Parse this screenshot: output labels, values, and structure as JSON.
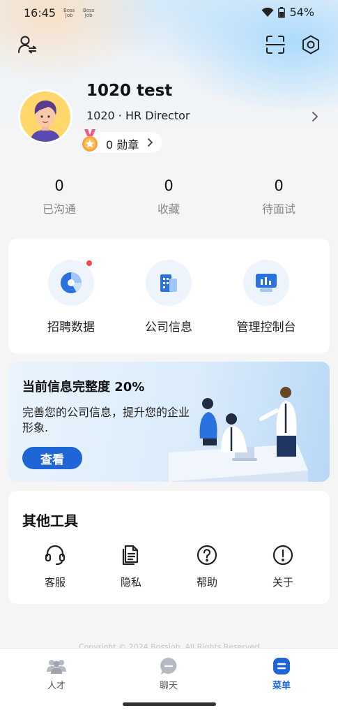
{
  "status_bar": {
    "time": "16:45",
    "mini_logo_line1": "Boss",
    "mini_logo_line2": "Job",
    "battery": "54%"
  },
  "header": {
    "left_icon": "user-switch-icon",
    "scan_icon": "scan-icon",
    "settings_icon": "settings-icon"
  },
  "profile": {
    "name": "1020 test",
    "role": "1020 · HR Director",
    "badge_count": "0 勋章"
  },
  "stats": [
    {
      "value": "0",
      "label": "已沟通"
    },
    {
      "value": "0",
      "label": "收藏"
    },
    {
      "value": "0",
      "label": "待面试"
    }
  ],
  "quick_actions": [
    {
      "label": "招聘数据",
      "icon": "pie-chart-icon",
      "has_dot": true
    },
    {
      "label": "公司信息",
      "icon": "building-icon",
      "has_dot": false
    },
    {
      "label": "管理控制台",
      "icon": "dashboard-icon",
      "has_dot": false
    }
  ],
  "banner": {
    "title": "当前信息完整度 20%",
    "description": "完善您的公司信息，提升您的企业形象.",
    "button_label": "查看",
    "completeness_percent": 20
  },
  "tools": {
    "title": "其他工具",
    "items": [
      {
        "label": "客服",
        "icon": "headset-icon"
      },
      {
        "label": "隐私",
        "icon": "document-icon"
      },
      {
        "label": "帮助",
        "icon": "question-icon"
      },
      {
        "label": "关于",
        "icon": "info-icon"
      }
    ]
  },
  "copyright": "Copyright © 2024 Bossjob. All Rights Reserved",
  "tabbar": {
    "items": [
      {
        "label": "人才",
        "icon": "people-icon",
        "active": false
      },
      {
        "label": "聊天",
        "icon": "chat-icon",
        "active": false
      },
      {
        "label": "菜单",
        "icon": "menu-icon",
        "active": true
      }
    ]
  },
  "colors": {
    "primary": "#1e66d6",
    "background": "#f5f5f5",
    "dot": "#f04848"
  }
}
